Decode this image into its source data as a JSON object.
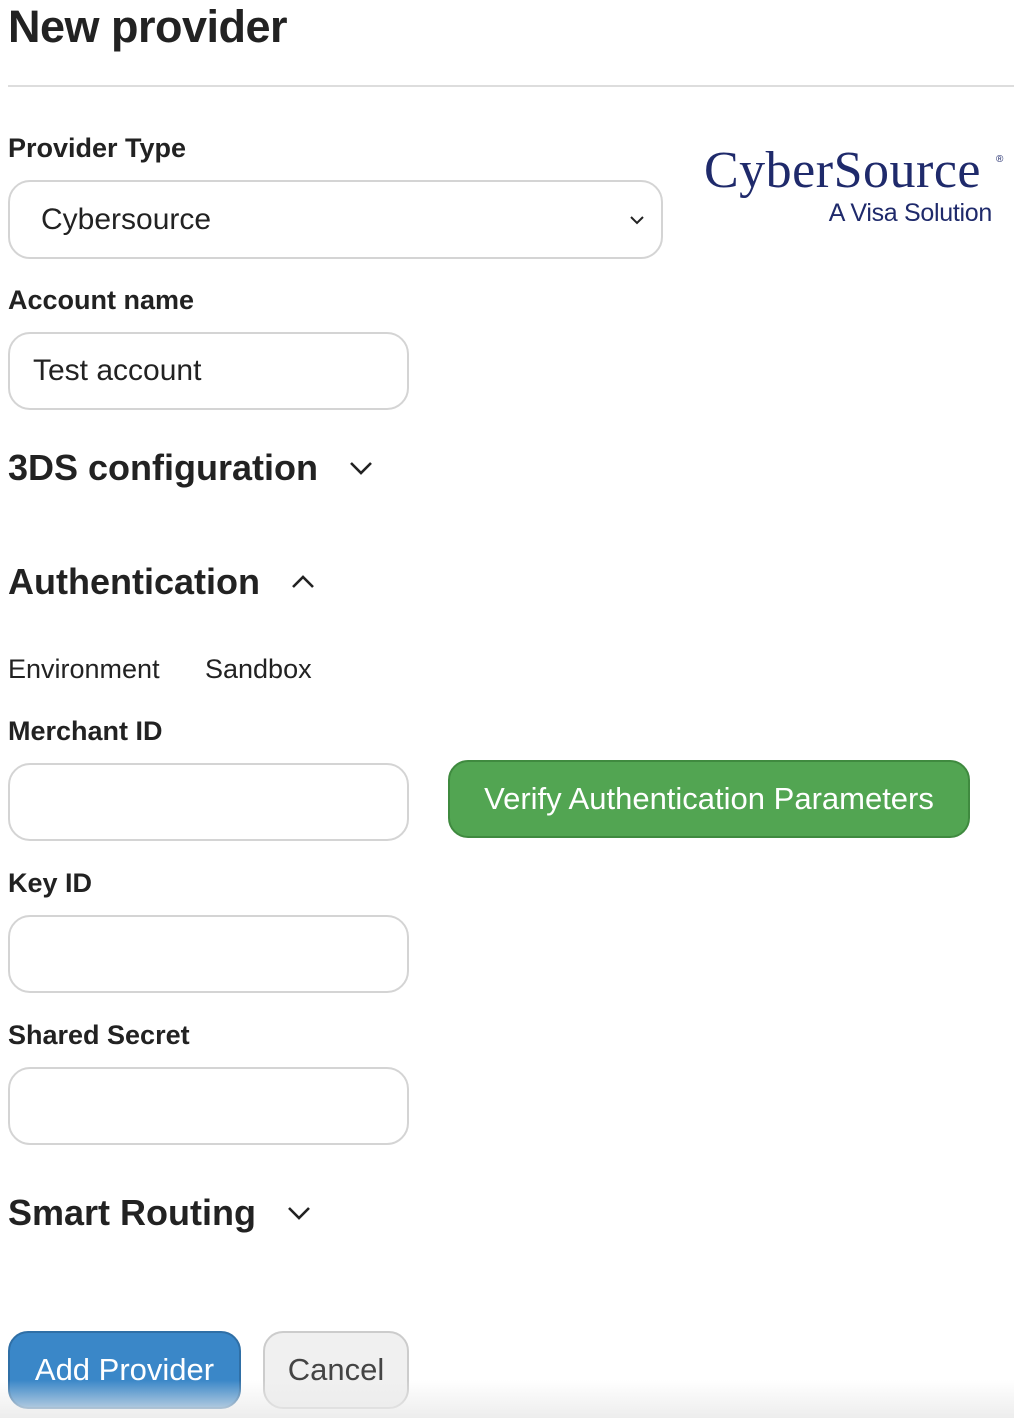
{
  "page": {
    "title": "New provider"
  },
  "provider_type": {
    "label": "Provider Type",
    "selected": "Cybersource",
    "logo": {
      "name": "CyberSource",
      "registered_mark": "®",
      "tagline": "A Visa Solution",
      "color": "#1f2a6b"
    }
  },
  "account_name": {
    "label": "Account name",
    "value": "Test account"
  },
  "sections": {
    "threeds": {
      "title": "3DS configuration",
      "state": "collapsed",
      "icon": "chevron-down-icon"
    },
    "authentication": {
      "title": "Authentication",
      "state": "expanded",
      "icon": "chevron-up-icon"
    },
    "smart_routing": {
      "title": "Smart Routing",
      "state": "collapsed",
      "icon": "chevron-down-icon"
    }
  },
  "authentication": {
    "environment_label": "Environment",
    "environment_value": "Sandbox",
    "merchant_id": {
      "label": "Merchant ID",
      "value": ""
    },
    "key_id": {
      "label": "Key ID",
      "value": ""
    },
    "shared_secret": {
      "label": "Shared Secret",
      "value": ""
    },
    "verify_button": "Verify Authentication Parameters"
  },
  "actions": {
    "add_label": "Add Provider",
    "cancel_label": "Cancel"
  },
  "colors": {
    "success": "#52a552",
    "primary": "#3a87c8",
    "secondary": "#f0f0f0"
  }
}
